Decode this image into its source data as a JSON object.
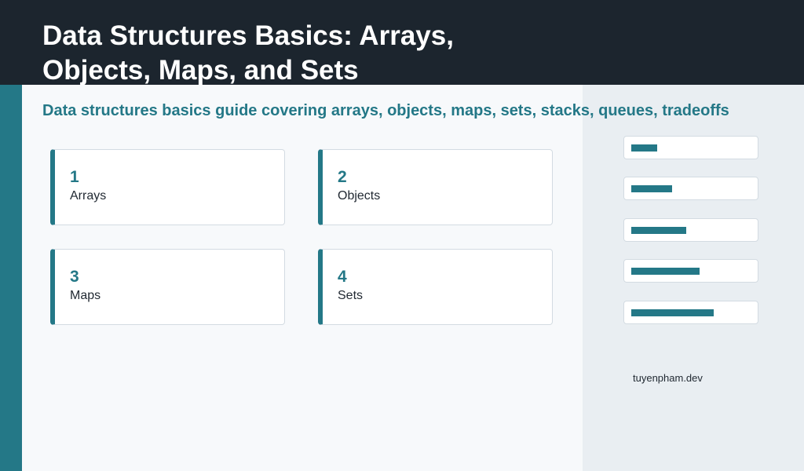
{
  "header": {
    "title": "Data Structures Basics: Arrays, Objects, Maps, and Sets"
  },
  "subtitle": "Data structures basics guide covering arrays, objects, maps, sets, stacks, queues, tradeoffs",
  "cards": [
    {
      "number": "1",
      "label": "Arrays"
    },
    {
      "number": "2",
      "label": "Objects"
    },
    {
      "number": "3",
      "label": "Maps"
    },
    {
      "number": "4",
      "label": "Sets"
    }
  ],
  "progress_bars": [
    {
      "level": 0.22
    },
    {
      "level": 0.34
    },
    {
      "level": 0.46
    },
    {
      "level": 0.57
    },
    {
      "level": 0.69
    }
  ],
  "footer": {
    "domain": "tuyenpham.dev"
  },
  "colors": {
    "header_bg": "#1c252e",
    "accent": "#247887",
    "panel_bg": "#e9eef2",
    "page_bg": "#f7f9fb"
  }
}
